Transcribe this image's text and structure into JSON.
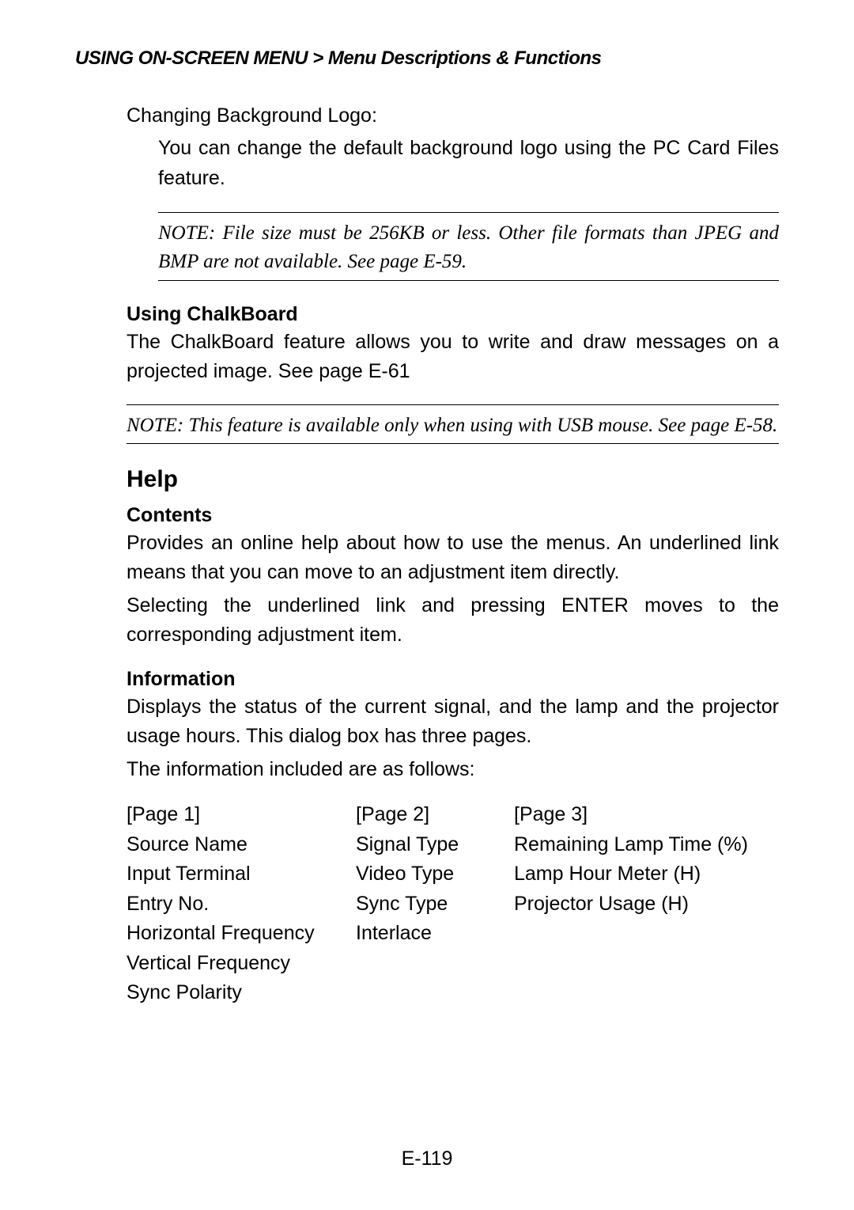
{
  "breadcrumb": {
    "part1": "USING ON-SCREEN MENU",
    "part2": "Menu Descriptions & Functions"
  },
  "section1": {
    "title": "Changing Background Logo:",
    "body": "You can change the default background logo using the PC Card Files feature.",
    "note": "NOTE: File size must be 256KB or less. Other file formats than JPEG and BMP are not available. See page E-59."
  },
  "section2": {
    "heading": "Using ChalkBoard",
    "body": "The ChalkBoard feature allows you to write and draw messages on a projected image. See page E-61",
    "note": "NOTE: This feature is available only when using with USB mouse. See page E-58."
  },
  "help": {
    "heading": "Help",
    "contents": {
      "heading": "Contents",
      "body1": "Provides an online help about how to use the menus. An underlined link means that you can move to an adjustment item directly.",
      "body2": "Selecting the underlined link and pressing ENTER moves to the corresponding adjustment item."
    },
    "information": {
      "heading": "Information",
      "body1": "Displays the status of the current signal, and the lamp and the projector usage hours. This dialog box has three pages.",
      "body2": "The information included are as follows:",
      "pages": {
        "p1": {
          "header": "[Page 1]",
          "r1": "Source Name",
          "r2": "Input Terminal",
          "r3": "Entry No.",
          "r4": "Horizontal Frequency",
          "r5": "Vertical Frequency",
          "r6": "Sync Polarity"
        },
        "p2": {
          "header": "[Page 2]",
          "r1": "Signal Type",
          "r2": "Video Type",
          "r3": "Sync Type",
          "r4": "Interlace"
        },
        "p3": {
          "header": "[Page 3]",
          "r1": "Remaining Lamp Time (%)",
          "r2": "Lamp Hour Meter (H)",
          "r3": "Projector Usage (H)"
        }
      }
    }
  },
  "pageNumber": "E-119"
}
